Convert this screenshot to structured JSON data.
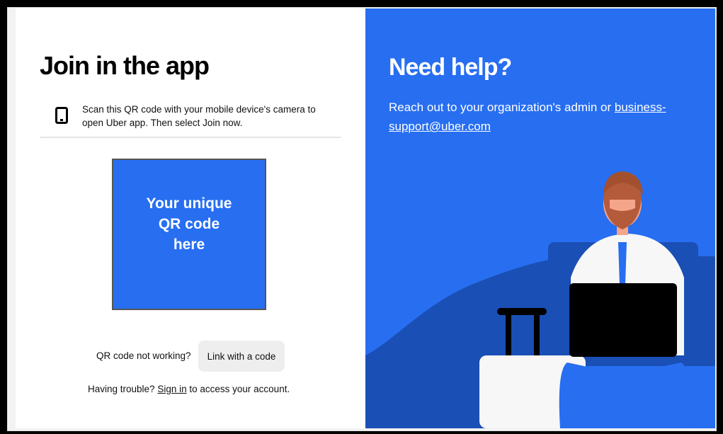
{
  "left": {
    "title": "Join in the app",
    "instruction_line1": "Scan this QR code with your mobile device's camera to",
    "instruction_line2": "open Uber app. Then select Join now.",
    "phone_icon": "mobile-phone-icon",
    "qr_placeholder_lines": [
      "Your unique",
      "QR code",
      "here"
    ],
    "qr_not_working_text": "QR code not working?",
    "link_code_button_label": "Link with a code",
    "trouble_prefix": "Having trouble?",
    "sign_in_link": "Sign in",
    "trouble_suffix": "to access your account."
  },
  "right": {
    "title": "Need help?",
    "help_text_prefix": "Reach out to your organization's admin or",
    "support_email": "business-support@uber.com",
    "illustration": "man-with-laptop-and-suitcase-illustration"
  },
  "colors": {
    "brand_blue": "#276ef1",
    "dark_blue": "#1a4fb5",
    "text_primary": "#000000"
  }
}
